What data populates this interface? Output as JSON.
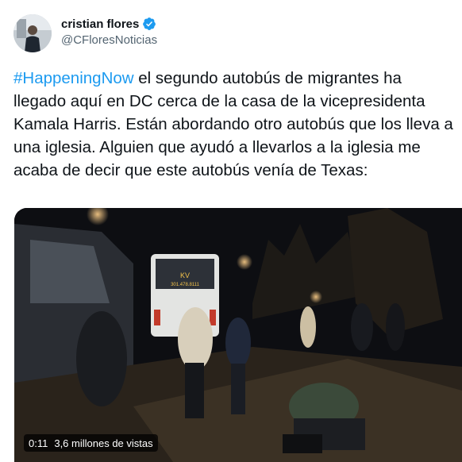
{
  "author": {
    "display_name": "cristian flores",
    "handle": "@CFloresNoticias"
  },
  "tweet": {
    "hashtag": "#HappeningNow",
    "body": " el segundo autobús de migrantes ha llegado aquí en DC cerca de la casa de la vicepresidenta Kamala Harris. Están abordando otro autobús que los lleva a una iglesia. Alguien que ayudó a llevarlos a la iglesia me acaba de decir que este autobús venía de Texas:"
  },
  "media": {
    "bus_sign": "KV",
    "bus_phone": "301.478.8111",
    "duration": "0:11",
    "views": "3,6 millones de vistas"
  },
  "colors": {
    "accent": "#1d9bf0",
    "text": "#0f1419",
    "secondary": "#536471"
  }
}
